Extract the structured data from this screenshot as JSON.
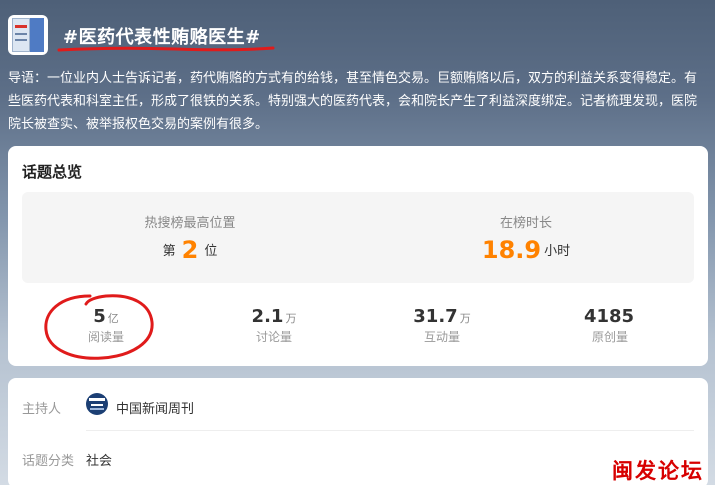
{
  "topic": {
    "title": "#医药代表性贿赂医生#",
    "intro": "导语：一位业内人士告诉记者，药代贿赂的方式有的给钱，甚至情色交易。巨额贿赂以后，双方的利益关系变得稳定。有些医药代表和科室主任，形成了很铁的关系。特别强大的医药代表，会和院长产生了利益深度绑定。记者梳理发现，医院院长被查实、被举报权色交易的案例有很多。"
  },
  "overview": {
    "title": "话题总览",
    "peak": {
      "label": "热搜榜最高位置",
      "prefix": "第",
      "value": "2",
      "suffix": "位"
    },
    "duration": {
      "label": "在榜时长",
      "value": "18.9",
      "unit": "小时"
    },
    "stats": [
      {
        "value": "5",
        "unit": "亿",
        "label": "阅读量"
      },
      {
        "value": "2.1",
        "unit": "万",
        "label": "讨论量"
      },
      {
        "value": "31.7",
        "unit": "万",
        "label": "互动量"
      },
      {
        "value": "4185",
        "unit": "",
        "label": "原创量"
      }
    ]
  },
  "info": {
    "host_label": "主持人",
    "host_name": "中国新闻周刊",
    "category_label": "话题分类",
    "category_value": "社会"
  },
  "watermark": "闽发论坛",
  "colors": {
    "accent": "#ff8200",
    "annotation": "#e01b1b",
    "watermark": "#d70000"
  }
}
